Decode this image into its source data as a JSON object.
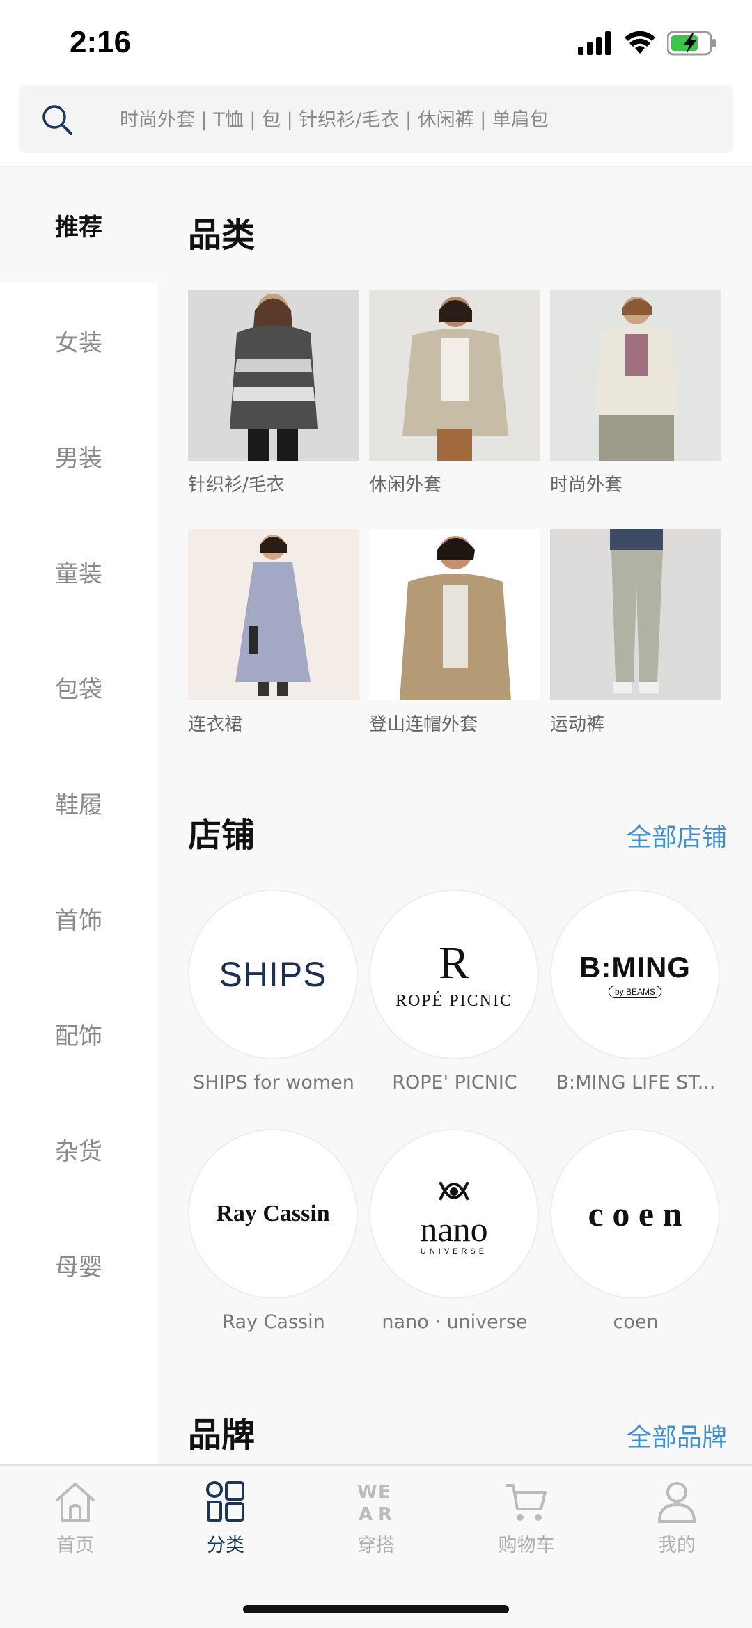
{
  "status_bar": {
    "time": "2:16"
  },
  "search": {
    "placeholder": "时尚外套 | T恤 | 包 | 针织衫/毛衣 | 休闲裤 | 单肩包"
  },
  "sidebar": {
    "items": [
      {
        "label": "推荐",
        "active": true
      },
      {
        "label": "女装"
      },
      {
        "label": "男装"
      },
      {
        "label": "童装"
      },
      {
        "label": "包袋"
      },
      {
        "label": "鞋履"
      },
      {
        "label": "首饰"
      },
      {
        "label": "配饰"
      },
      {
        "label": "杂货"
      },
      {
        "label": "母婴"
      }
    ]
  },
  "categories": {
    "title": "品类",
    "items": [
      {
        "label": "针织衫/毛衣"
      },
      {
        "label": "休闲外套"
      },
      {
        "label": "时尚外套"
      },
      {
        "label": "连衣裙"
      },
      {
        "label": "登山连帽外套"
      },
      {
        "label": "运动裤"
      }
    ]
  },
  "shops": {
    "title": "店铺",
    "all_link": "全部店铺",
    "items": [
      {
        "name": "SHIPS for women",
        "logo_text": "SHIPS"
      },
      {
        "name": "ROPE' PICNIC",
        "logo_text": "ROPÉ PICNIC",
        "logo_mark": "R"
      },
      {
        "name": "B:MING LIFE ST...",
        "logo_text": "B:MING",
        "logo_sub": "by BEAMS"
      },
      {
        "name": "Ray Cassin",
        "logo_text": "Ray Cassin"
      },
      {
        "name": "nano · universe",
        "logo_text": "nano",
        "logo_sub": "UNIVERSE"
      },
      {
        "name": "coen",
        "logo_text": "c o e n"
      }
    ]
  },
  "brands": {
    "title": "品牌",
    "all_link": "全部品牌"
  },
  "tabbar": {
    "items": [
      {
        "label": "首页",
        "icon": "home-icon"
      },
      {
        "label": "分类",
        "icon": "category-icon",
        "active": true
      },
      {
        "label": "穿搭",
        "icon": "wear-icon",
        "icon_text": "WEAR"
      },
      {
        "label": "购物车",
        "icon": "cart-icon"
      },
      {
        "label": "我的",
        "icon": "profile-icon"
      }
    ]
  },
  "colors": {
    "accent": "#3d8fd1",
    "active_tab": "#1c3558",
    "ships_navy": "#1d2f52"
  }
}
